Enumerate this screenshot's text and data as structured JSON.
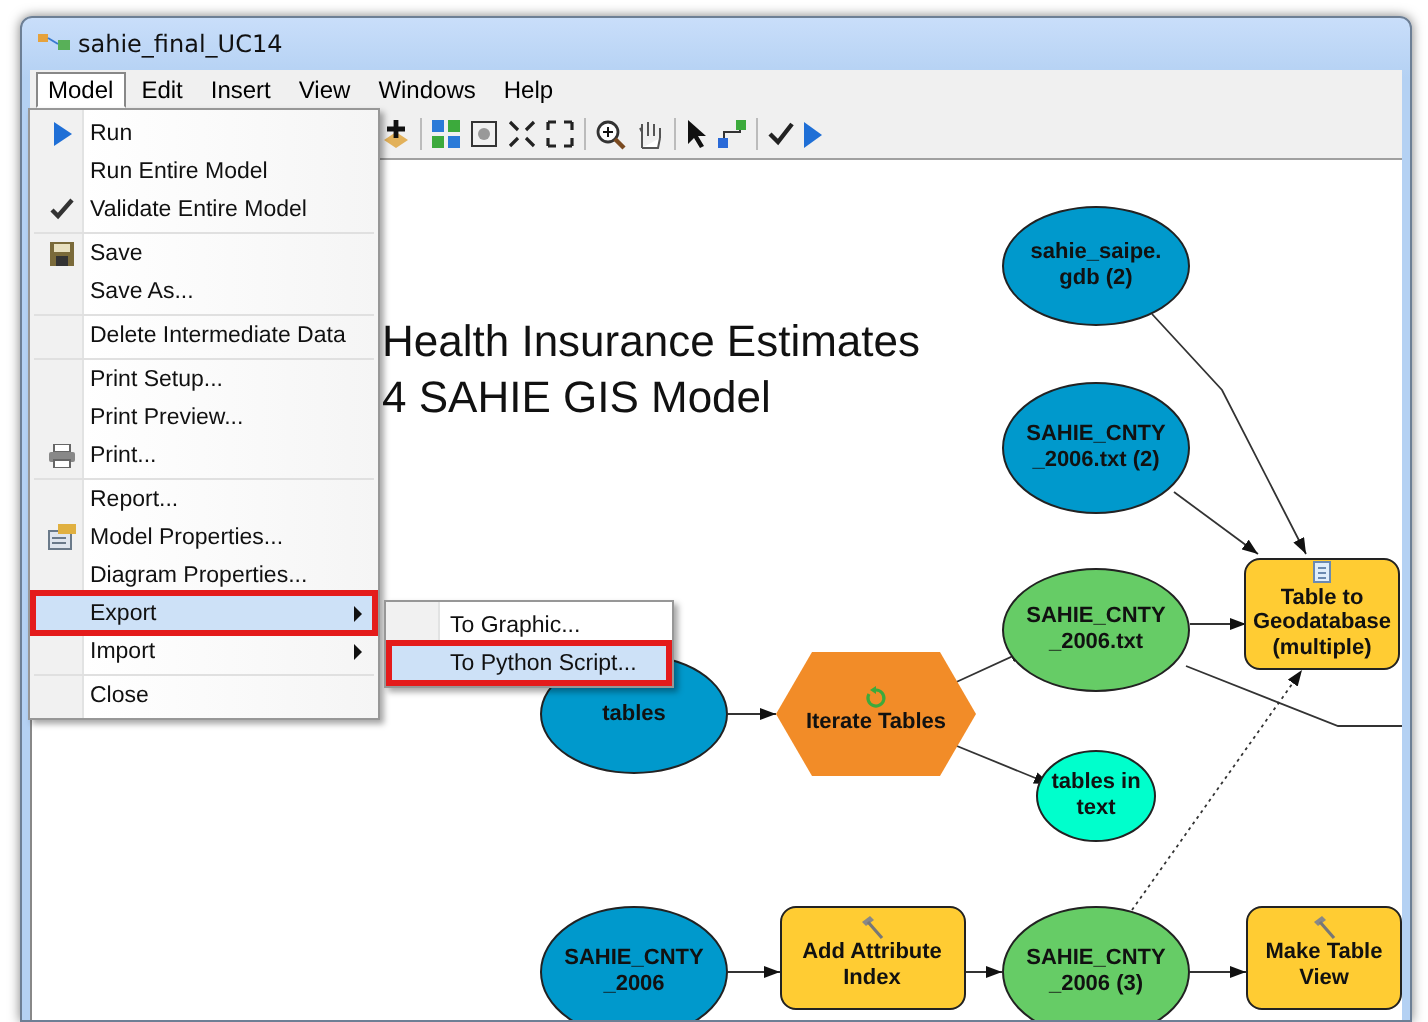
{
  "window": {
    "title": "sahie_final_UC14"
  },
  "menubar": [
    {
      "label": "Model",
      "selected": true
    },
    {
      "label": "Edit",
      "selected": false
    },
    {
      "label": "Insert",
      "selected": false
    },
    {
      "label": "View",
      "selected": false
    },
    {
      "label": "Windows",
      "selected": false
    },
    {
      "label": "Help",
      "selected": false
    }
  ],
  "model_menu": [
    {
      "label": "Run",
      "kind": "run",
      "separator_before": false,
      "selected": false,
      "submenu": false
    },
    {
      "label": "Run Entire Model",
      "kind": "plain",
      "separator_before": false,
      "selected": false,
      "submenu": false
    },
    {
      "label": "Validate Entire Model",
      "kind": "check",
      "separator_before": false,
      "selected": false,
      "submenu": false
    },
    {
      "label": "Save",
      "kind": "save",
      "separator_before": true,
      "selected": false,
      "submenu": false
    },
    {
      "label": "Save As...",
      "kind": "plain",
      "separator_before": false,
      "selected": false,
      "submenu": false
    },
    {
      "label": "Delete Intermediate Data",
      "kind": "plain",
      "separator_before": true,
      "selected": false,
      "submenu": false
    },
    {
      "label": "Print Setup...",
      "kind": "plain",
      "separator_before": true,
      "selected": false,
      "submenu": false
    },
    {
      "label": "Print Preview...",
      "kind": "plain",
      "separator_before": false,
      "selected": false,
      "submenu": false
    },
    {
      "label": "Print...",
      "kind": "print",
      "separator_before": false,
      "selected": false,
      "submenu": false
    },
    {
      "label": "Report...",
      "kind": "plain",
      "separator_before": true,
      "selected": false,
      "submenu": false
    },
    {
      "label": "Model Properties...",
      "kind": "properties",
      "separator_before": false,
      "selected": false,
      "submenu": false
    },
    {
      "label": "Diagram Properties...",
      "kind": "plain",
      "separator_before": false,
      "selected": false,
      "submenu": false
    },
    {
      "label": "Export",
      "kind": "plain",
      "separator_before": false,
      "selected": true,
      "submenu": true
    },
    {
      "label": "Import",
      "kind": "plain",
      "separator_before": false,
      "selected": false,
      "submenu": true
    },
    {
      "label": "Close",
      "kind": "plain",
      "separator_before": true,
      "selected": false,
      "submenu": false
    }
  ],
  "export_submenu": [
    {
      "label": "To Graphic...",
      "selected": false
    },
    {
      "label": "To Python Script...",
      "selected": true
    }
  ],
  "diagram": {
    "title_lines": [
      "Health Insurance Estimates",
      "4 SAHIE GIS Model"
    ],
    "nodes": [
      {
        "label": "sahie_saipe. gdb (2)",
        "kind": "variable",
        "color": "#0099cc"
      },
      {
        "label": "SAHIE_CNTY_2006.txt (2)",
        "kind": "variable",
        "color": "#0099cc"
      },
      {
        "label": "SAHIE_CNTY_2006.txt",
        "kind": "variable",
        "color": "#66cc66"
      },
      {
        "label": "Table to Geodatabase (multiple)",
        "kind": "script_tool",
        "color": "#ffcc33"
      },
      {
        "label": "tables",
        "kind": "variable",
        "color": "#0099cc"
      },
      {
        "label": "Iterate Tables",
        "kind": "iterator",
        "color": "#f28c28"
      },
      {
        "label": "tables in text",
        "kind": "variable",
        "color": "#00ffcc"
      },
      {
        "label": "SAHIE_CNTY_2006",
        "kind": "variable",
        "color": "#0099cc"
      },
      {
        "label": "Add Attribute Index",
        "kind": "tool",
        "color": "#ffcc33"
      },
      {
        "label": "SAHIE_CNTY_2006 (3)",
        "kind": "variable",
        "color": "#66cc66"
      },
      {
        "label": "Make Table View",
        "kind": "tool",
        "color": "#ffcc33"
      }
    ]
  }
}
